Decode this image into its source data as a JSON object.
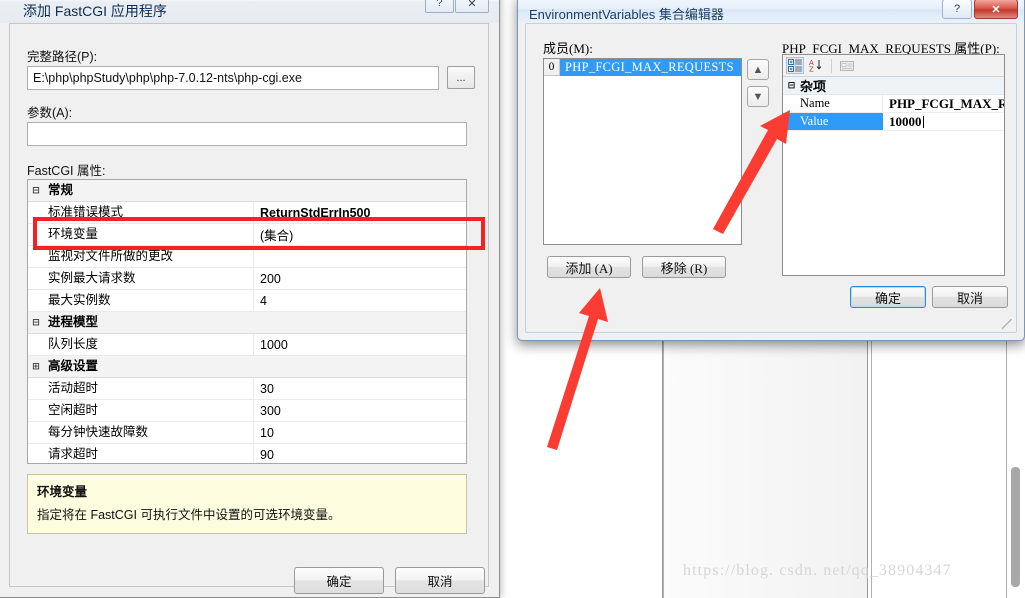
{
  "background": {
    "watermark": "https://blog. csdn. net/qq_38904347"
  },
  "dialog1": {
    "title": "添加 FastCGI 应用程序",
    "help_button": "?",
    "close_button": "✕",
    "path_label": "完整路径(P):",
    "path_value": "E:\\php\\phpStudy\\php\\php-7.0.12-nts\\php-cgi.exe",
    "browse_button": "...",
    "args_label": "参数(A):",
    "args_value": "",
    "props_label": "FastCGI 属性:",
    "grid": [
      {
        "type": "category",
        "expander": "⊟",
        "name": "常规",
        "value": ""
      },
      {
        "type": "prop",
        "expander": "",
        "name": "标准错误模式",
        "value": "ReturnStdErrIn500",
        "bold": true
      },
      {
        "type": "prop",
        "expander": "",
        "name": "环境变量",
        "value": "(集合)",
        "bold": false
      },
      {
        "type": "prop",
        "expander": "",
        "name": "监视对文件所做的更改",
        "value": "",
        "bold": false
      },
      {
        "type": "prop",
        "expander": "",
        "name": "实例最大请求数",
        "value": "200",
        "bold": false
      },
      {
        "type": "prop",
        "expander": "",
        "name": "最大实例数",
        "value": "4",
        "bold": false
      },
      {
        "type": "category",
        "expander": "⊟",
        "name": "进程模型",
        "value": ""
      },
      {
        "type": "prop",
        "expander": "",
        "name": "队列长度",
        "value": "1000",
        "bold": false
      },
      {
        "type": "category2",
        "expander": "⊞",
        "name": "高级设置",
        "value": ""
      },
      {
        "type": "prop",
        "expander": "",
        "name": "活动超时",
        "value": "30",
        "bold": false
      },
      {
        "type": "prop",
        "expander": "",
        "name": "空闲超时",
        "value": "300",
        "bold": false
      },
      {
        "type": "prop",
        "expander": "",
        "name": "每分钟快速故障数",
        "value": "10",
        "bold": false
      },
      {
        "type": "prop",
        "expander": "",
        "name": "请求超时",
        "value": "90",
        "bold": false
      }
    ],
    "description": {
      "title": "环境变量",
      "text": "指定将在 FastCGI 可执行文件中设置的可选环境变量。"
    },
    "ok_button": "确定",
    "cancel_button": "取消"
  },
  "dialog2": {
    "title": "EnvironmentVariables 集合编辑器",
    "help_button": "?",
    "close_button": "✕",
    "members_label": "成员(M):",
    "members": [
      {
        "index": "0",
        "name": "PHP_FCGI_MAX_REQUESTS",
        "selected": true
      }
    ],
    "move_up_button": "▲",
    "move_down_button": "▼",
    "add_button": "添加 (A)",
    "remove_button": "移除 (R)",
    "properties_label": "PHP_FCGI_MAX_REQUESTS 属性(P):",
    "toolbar": {
      "categorized_icon": "categorized-view-icon",
      "alphabetical_icon": "alphabetical-sort-icon",
      "property_pages_icon": "property-pages-icon"
    },
    "prop_grid": {
      "category": "杂项",
      "category_expander": "⊟",
      "rows": [
        {
          "name": "Name",
          "value": "PHP_FCGI_MAX_REQU",
          "selected": false,
          "editing": false
        },
        {
          "name": "Value",
          "value": "10000",
          "selected": true,
          "editing": true
        }
      ]
    },
    "ok_button": "确定",
    "cancel_button": "取消"
  },
  "annotations": {
    "highlight_color": "#f42222",
    "arrow_color": "#fa3c32",
    "arrow1_label": "arrow-to-value-field",
    "arrow2_label": "arrow-to-add-button",
    "highlight_label": "environment-variables-row-highlight"
  }
}
